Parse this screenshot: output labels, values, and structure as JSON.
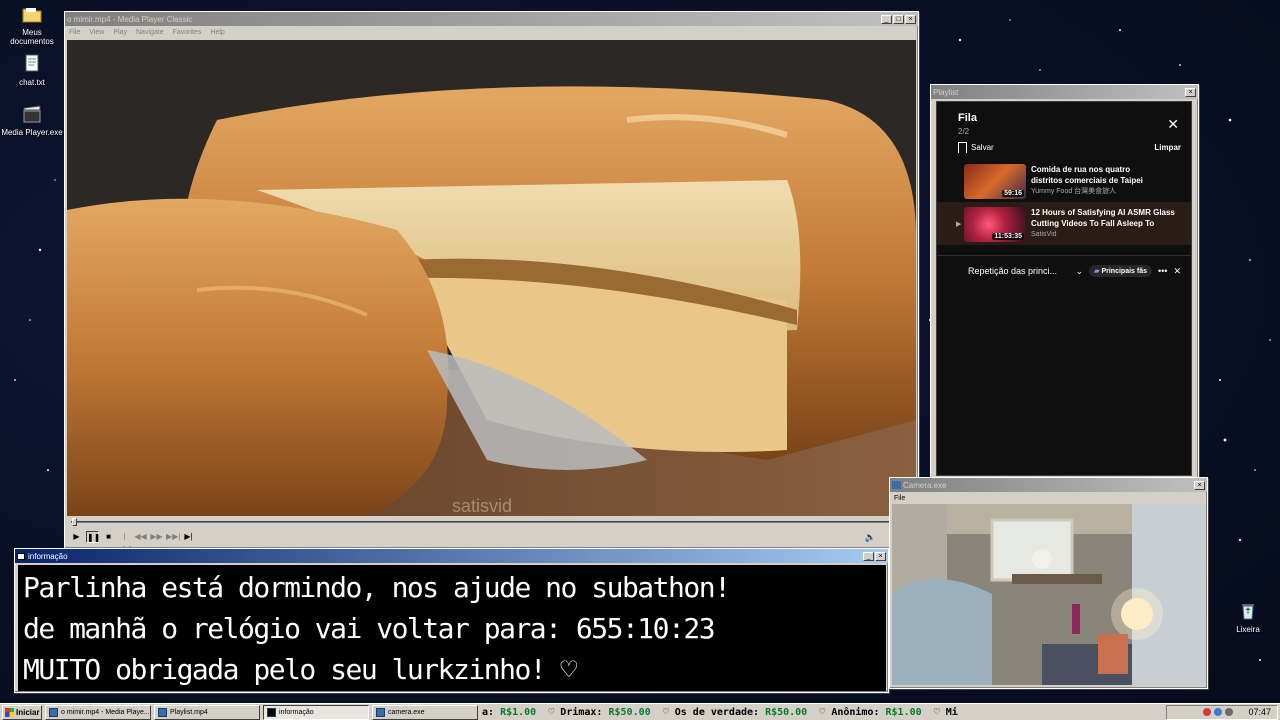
{
  "desktop": {
    "icons": [
      {
        "label": "Meus documentos"
      },
      {
        "label": "chat.txt"
      },
      {
        "label": "Media Player.exe"
      },
      {
        "label": "Lixeira"
      }
    ]
  },
  "media_player": {
    "title": "o mimir.mp4 - Media Player Classic",
    "menu": [
      "File",
      "View",
      "Play",
      "Navigate",
      "Favorites",
      "Help"
    ],
    "watermark": "satisvid"
  },
  "playlist": {
    "window_title": "Playlist",
    "queue_title": "Fila",
    "queue_count": "2/2",
    "save_label": "Salvar",
    "clear_label": "Limpar",
    "videos": [
      {
        "title_line1": "Comida de rua nos quatro",
        "title_line2": "distritos comerciais de Taipei",
        "channel": "Yummy Food 台灣美食旅人",
        "duration": "59:16",
        "current": false
      },
      {
        "title_line1": "12 Hours of Satisfying AI ASMR Glass",
        "title_line2": "Cutting Videos To Fall Asleep To",
        "channel": "SatisVid",
        "duration": "11:53:35",
        "current": true
      }
    ],
    "mix_label": "Repetição das princi...",
    "badge_label": "Principais fãs"
  },
  "info_window": {
    "title": "informação",
    "lines": [
      "Parlinha está dormindo, nos ajude no subathon!",
      "de manhã o relógio vai voltar para:  655:10:23",
      "MUITO obrigada pelo seu lurkzinho! ♡"
    ]
  },
  "camera": {
    "title": "Camera.exe",
    "menu_file": "File"
  },
  "taskbar": {
    "start_label": "Iniciar",
    "tasks": [
      {
        "label": "o mimir.mp4 - Media Playe...",
        "active": false
      },
      {
        "label": "Playlist.mp4",
        "active": false
      },
      {
        "label": "informação",
        "active": true
      },
      {
        "label": "camera.exe",
        "active": false
      }
    ],
    "ticker": [
      {
        "name": "a:",
        "amount": "R$1.00"
      },
      {
        "name": "Drimax:",
        "amount": "R$50.00"
      },
      {
        "name": "Os de verdade:",
        "amount": "R$50.00"
      },
      {
        "name": "Anônimo:",
        "amount": "R$1.00"
      },
      {
        "name": "Mi",
        "amount": ""
      }
    ],
    "clock": "07:47"
  }
}
